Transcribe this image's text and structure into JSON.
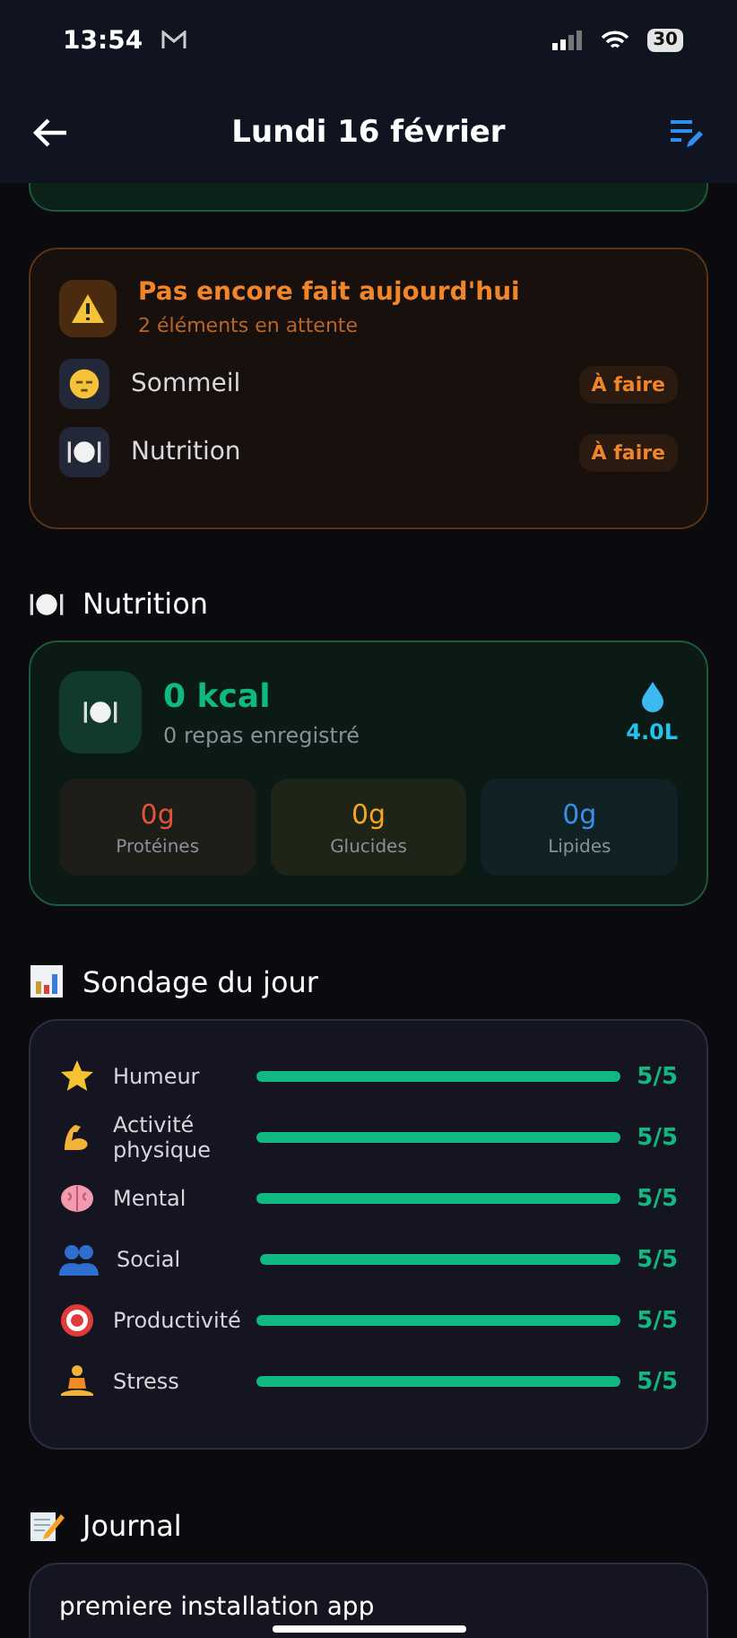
{
  "status_bar": {
    "time": "13:54",
    "battery": "30"
  },
  "header": {
    "title": "Lundi 16 février"
  },
  "pending": {
    "title": "Pas encore fait aujourd'hui",
    "subtitle": "2 éléments en attente",
    "items": [
      {
        "kind": "sleep",
        "label": "Sommeil",
        "badge": "À faire"
      },
      {
        "kind": "meal",
        "label": "Nutrition",
        "badge": "À faire"
      }
    ]
  },
  "nutrition": {
    "heading": "Nutrition",
    "kcal": "0 kcal",
    "meals": "0 repas enregistré",
    "water": "4.0L",
    "macros": [
      {
        "value": "0g",
        "label": "Protéines",
        "color": "#e5533d"
      },
      {
        "value": "0g",
        "label": "Glucides",
        "color": "#f5a524"
      },
      {
        "value": "0g",
        "label": "Lipides",
        "color": "#3b8fe8"
      }
    ]
  },
  "survey": {
    "heading": "Sondage du jour",
    "items": [
      {
        "kind": "star",
        "label": "Humeur",
        "level": 1,
        "score": "5/5"
      },
      {
        "kind": "muscle",
        "label": "Activité physique",
        "level": 1,
        "score": "5/5"
      },
      {
        "kind": "brain",
        "label": "Mental",
        "level": 1,
        "score": "5/5"
      },
      {
        "kind": "people",
        "label": "Social",
        "level": 1,
        "score": "5/5"
      },
      {
        "kind": "target",
        "label": "Productivité",
        "level": 1,
        "score": "5/5"
      },
      {
        "kind": "meditate",
        "label": "Stress",
        "level": 1,
        "score": "5/5"
      }
    ]
  },
  "journal": {
    "heading": "Journal",
    "entry": "premiere installation app"
  }
}
